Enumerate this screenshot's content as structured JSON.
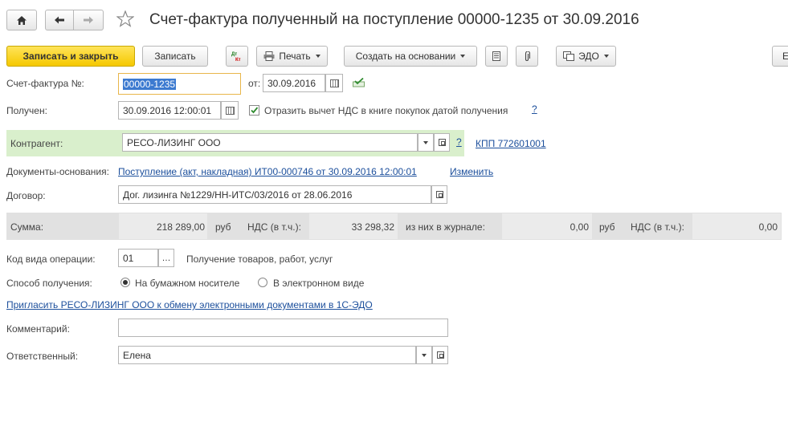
{
  "title": "Счет-фактура полученный на поступление 00000-1235 от 30.09.2016",
  "toolbar": {
    "save_close": "Записать и закрыть",
    "save": "Записать",
    "print": "Печать",
    "create_based": "Создать на основании",
    "edo": "ЭДО",
    "more": "Е"
  },
  "form": {
    "invoice_no_label": "Счет-фактура №:",
    "invoice_no": "00000-1235",
    "from_label": "от:",
    "from_date": "30.09.2016",
    "received_label": "Получен:",
    "received_datetime": "30.09.2016 12:00:01",
    "vat_checkbox_label": "Отразить вычет НДС в книге покупок датой получения",
    "vat_checkbox_checked": true,
    "help": "?",
    "contractor_label": "Контрагент:",
    "contractor": "РЕСО-ЛИЗИНГ ООО",
    "kpp": "КПП 772601001",
    "base_docs_label": "Документы-основания:",
    "base_doc": "Поступление (акт, накладная) ИТ00-000746 от 30.09.2016 12:00:01",
    "change": "Изменить",
    "contract_label": "Договор:",
    "contract": "Дог. лизинга №1229/НН-ИТС/03/2016 от 28.06.2016",
    "op_code_label": "Код вида операции:",
    "op_code": "01",
    "op_code_desc": "Получение товаров, работ, услуг",
    "receive_method_label": "Способ получения:",
    "paper": "На бумажном носителе",
    "electronic": "В электронном виде",
    "invite_link": "Пригласить РЕСО-ЛИЗИНГ ООО к обмену электронными документами в 1С-ЭДО",
    "comment_label": "Комментарий:",
    "comment": "",
    "responsible_label": "Ответственный:",
    "responsible": "Елена"
  },
  "sums": {
    "sum_label": "Сумма:",
    "sum": "218 289,00",
    "currency1": "руб",
    "vat_label": "НДС (в т.ч.):",
    "vat": "33 298,32",
    "journal_label": "из них в журнале:",
    "journal": "0,00",
    "currency2": "руб",
    "vat2_label": "НДС (в т.ч.):",
    "vat2": "0,00"
  },
  "colors": {
    "accent_yellow": "#f5c800",
    "link": "#1c4f9c",
    "contractor_bg": "#d9efcc",
    "sum_bg": "#e1e1e1"
  }
}
